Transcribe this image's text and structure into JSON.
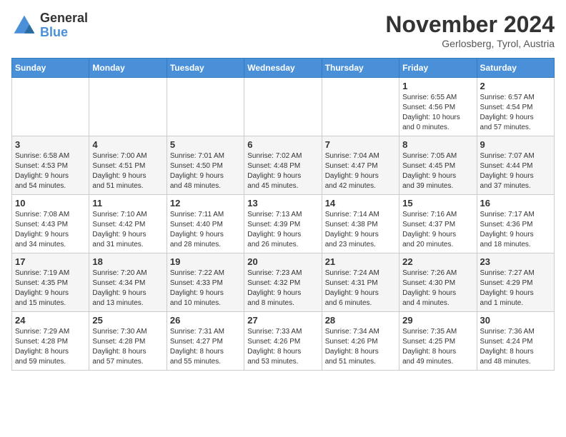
{
  "header": {
    "logo_line1": "General",
    "logo_line2": "Blue",
    "month": "November 2024",
    "location": "Gerlosberg, Tyrol, Austria"
  },
  "weekdays": [
    "Sunday",
    "Monday",
    "Tuesday",
    "Wednesday",
    "Thursday",
    "Friday",
    "Saturday"
  ],
  "weeks": [
    [
      {
        "day": "",
        "info": ""
      },
      {
        "day": "",
        "info": ""
      },
      {
        "day": "",
        "info": ""
      },
      {
        "day": "",
        "info": ""
      },
      {
        "day": "",
        "info": ""
      },
      {
        "day": "1",
        "info": "Sunrise: 6:55 AM\nSunset: 4:56 PM\nDaylight: 10 hours\nand 0 minutes."
      },
      {
        "day": "2",
        "info": "Sunrise: 6:57 AM\nSunset: 4:54 PM\nDaylight: 9 hours\nand 57 minutes."
      }
    ],
    [
      {
        "day": "3",
        "info": "Sunrise: 6:58 AM\nSunset: 4:53 PM\nDaylight: 9 hours\nand 54 minutes."
      },
      {
        "day": "4",
        "info": "Sunrise: 7:00 AM\nSunset: 4:51 PM\nDaylight: 9 hours\nand 51 minutes."
      },
      {
        "day": "5",
        "info": "Sunrise: 7:01 AM\nSunset: 4:50 PM\nDaylight: 9 hours\nand 48 minutes."
      },
      {
        "day": "6",
        "info": "Sunrise: 7:02 AM\nSunset: 4:48 PM\nDaylight: 9 hours\nand 45 minutes."
      },
      {
        "day": "7",
        "info": "Sunrise: 7:04 AM\nSunset: 4:47 PM\nDaylight: 9 hours\nand 42 minutes."
      },
      {
        "day": "8",
        "info": "Sunrise: 7:05 AM\nSunset: 4:45 PM\nDaylight: 9 hours\nand 39 minutes."
      },
      {
        "day": "9",
        "info": "Sunrise: 7:07 AM\nSunset: 4:44 PM\nDaylight: 9 hours\nand 37 minutes."
      }
    ],
    [
      {
        "day": "10",
        "info": "Sunrise: 7:08 AM\nSunset: 4:43 PM\nDaylight: 9 hours\nand 34 minutes."
      },
      {
        "day": "11",
        "info": "Sunrise: 7:10 AM\nSunset: 4:42 PM\nDaylight: 9 hours\nand 31 minutes."
      },
      {
        "day": "12",
        "info": "Sunrise: 7:11 AM\nSunset: 4:40 PM\nDaylight: 9 hours\nand 28 minutes."
      },
      {
        "day": "13",
        "info": "Sunrise: 7:13 AM\nSunset: 4:39 PM\nDaylight: 9 hours\nand 26 minutes."
      },
      {
        "day": "14",
        "info": "Sunrise: 7:14 AM\nSunset: 4:38 PM\nDaylight: 9 hours\nand 23 minutes."
      },
      {
        "day": "15",
        "info": "Sunrise: 7:16 AM\nSunset: 4:37 PM\nDaylight: 9 hours\nand 20 minutes."
      },
      {
        "day": "16",
        "info": "Sunrise: 7:17 AM\nSunset: 4:36 PM\nDaylight: 9 hours\nand 18 minutes."
      }
    ],
    [
      {
        "day": "17",
        "info": "Sunrise: 7:19 AM\nSunset: 4:35 PM\nDaylight: 9 hours\nand 15 minutes."
      },
      {
        "day": "18",
        "info": "Sunrise: 7:20 AM\nSunset: 4:34 PM\nDaylight: 9 hours\nand 13 minutes."
      },
      {
        "day": "19",
        "info": "Sunrise: 7:22 AM\nSunset: 4:33 PM\nDaylight: 9 hours\nand 10 minutes."
      },
      {
        "day": "20",
        "info": "Sunrise: 7:23 AM\nSunset: 4:32 PM\nDaylight: 9 hours\nand 8 minutes."
      },
      {
        "day": "21",
        "info": "Sunrise: 7:24 AM\nSunset: 4:31 PM\nDaylight: 9 hours\nand 6 minutes."
      },
      {
        "day": "22",
        "info": "Sunrise: 7:26 AM\nSunset: 4:30 PM\nDaylight: 9 hours\nand 4 minutes."
      },
      {
        "day": "23",
        "info": "Sunrise: 7:27 AM\nSunset: 4:29 PM\nDaylight: 9 hours\nand 1 minute."
      }
    ],
    [
      {
        "day": "24",
        "info": "Sunrise: 7:29 AM\nSunset: 4:28 PM\nDaylight: 8 hours\nand 59 minutes."
      },
      {
        "day": "25",
        "info": "Sunrise: 7:30 AM\nSunset: 4:28 PM\nDaylight: 8 hours\nand 57 minutes."
      },
      {
        "day": "26",
        "info": "Sunrise: 7:31 AM\nSunset: 4:27 PM\nDaylight: 8 hours\nand 55 minutes."
      },
      {
        "day": "27",
        "info": "Sunrise: 7:33 AM\nSunset: 4:26 PM\nDaylight: 8 hours\nand 53 minutes."
      },
      {
        "day": "28",
        "info": "Sunrise: 7:34 AM\nSunset: 4:26 PM\nDaylight: 8 hours\nand 51 minutes."
      },
      {
        "day": "29",
        "info": "Sunrise: 7:35 AM\nSunset: 4:25 PM\nDaylight: 8 hours\nand 49 minutes."
      },
      {
        "day": "30",
        "info": "Sunrise: 7:36 AM\nSunset: 4:24 PM\nDaylight: 8 hours\nand 48 minutes."
      }
    ]
  ]
}
